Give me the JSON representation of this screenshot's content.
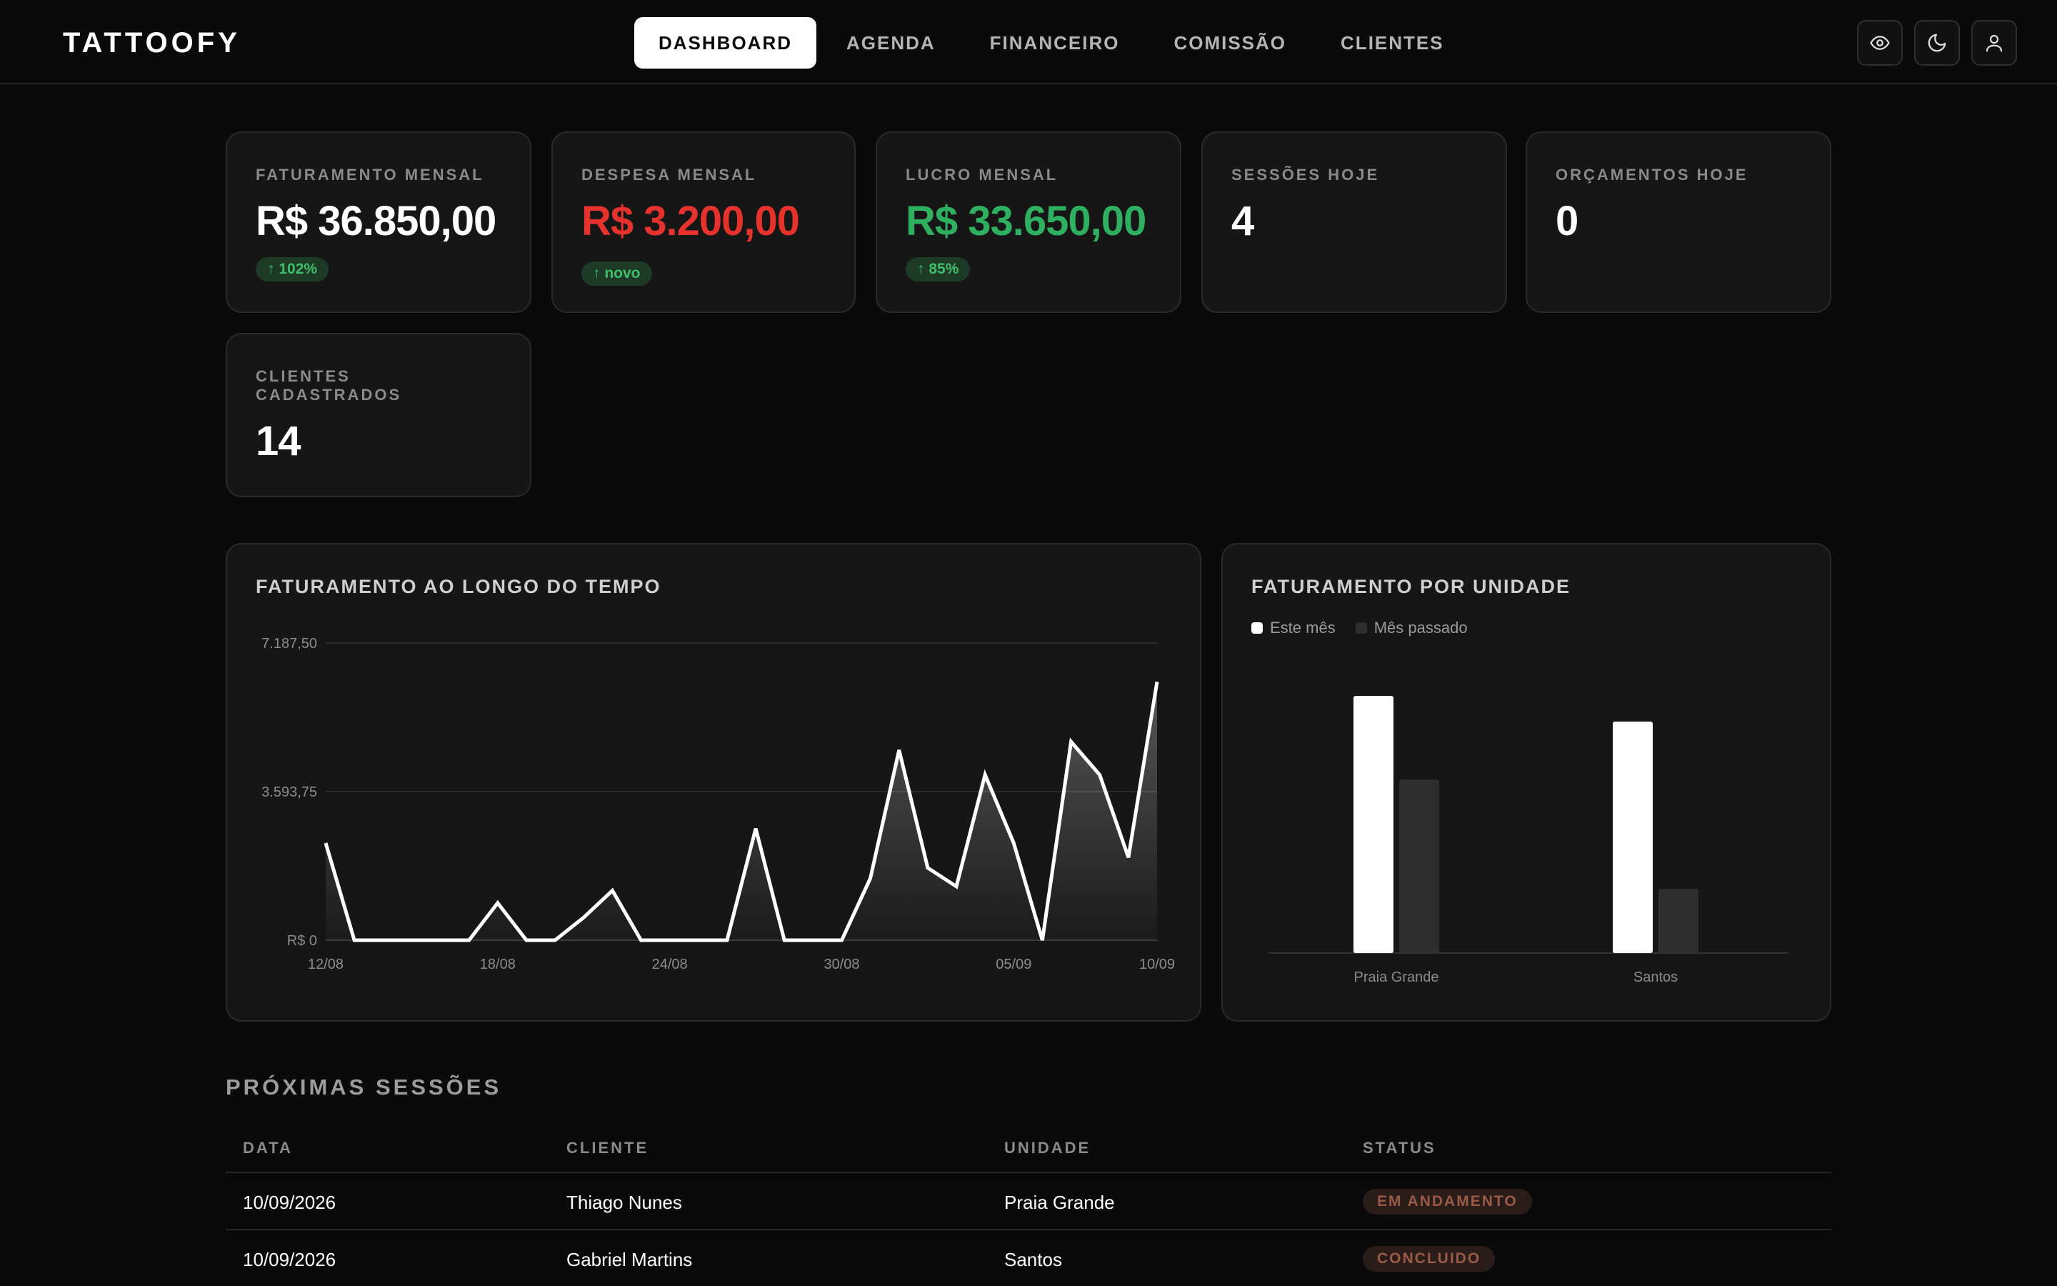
{
  "app": {
    "logo": "TATTOOFY"
  },
  "nav": {
    "items": [
      {
        "label": "DASHBOARD",
        "active": true
      },
      {
        "label": "AGENDA",
        "active": false
      },
      {
        "label": "FINANCEIRO",
        "active": false
      },
      {
        "label": "COMISSÃO",
        "active": false
      },
      {
        "label": "CLIENTES",
        "active": false
      }
    ]
  },
  "header_icons": [
    "eye-icon",
    "moon-icon",
    "user-icon"
  ],
  "stats": [
    {
      "label": "FATURAMENTO MENSAL",
      "value": "R$ 36.850,00",
      "badge": "↑ 102%",
      "color": "#ffffff"
    },
    {
      "label": "DESPESA MENSAL",
      "value": "R$ 3.200,00",
      "badge": "↑ novo",
      "color": "#e5322d"
    },
    {
      "label": "LUCRO MENSAL",
      "value": "R$ 33.650,00",
      "badge": "↑ 85%",
      "color": "#2fb061"
    },
    {
      "label": "SESSÕES HOJE",
      "value": "4"
    },
    {
      "label": "ORÇAMENTOS HOJE",
      "value": "0"
    },
    {
      "label": "CLIENTES CADASTRADOS",
      "value": "14"
    }
  ],
  "chart_data": [
    {
      "type": "area",
      "title": "FATURAMENTO AO LONGO DO TEMPO",
      "ylim": [
        0,
        7187.5
      ],
      "ytick_values": [
        0,
        3593.75,
        7187.5
      ],
      "ytick_labels": [
        "R$ 0",
        "3.593,75",
        "7.187,50"
      ],
      "xtick_labels": [
        "12/08",
        "18/08",
        "24/08",
        "30/08",
        "05/09",
        "10/09"
      ],
      "grid": true,
      "x": [
        "12/08",
        "13/08",
        "14/08",
        "15/08",
        "16/08",
        "17/08",
        "18/08",
        "19/08",
        "20/08",
        "21/08",
        "22/08",
        "23/08",
        "24/08",
        "25/08",
        "26/08",
        "27/08",
        "28/08",
        "29/08",
        "30/08",
        "31/08",
        "01/09",
        "02/09",
        "03/09",
        "04/09",
        "05/09",
        "06/09",
        "07/09",
        "08/09",
        "09/09",
        "10/09"
      ],
      "series": [
        {
          "values": [
            2350,
            0,
            0,
            0,
            0,
            0,
            900,
            0,
            0,
            550,
            1200,
            0,
            0,
            0,
            0,
            2700,
            0,
            0,
            0,
            1500,
            4600,
            1750,
            1300,
            4000,
            2350,
            0,
            4800,
            4000,
            2000,
            6250
          ]
        }
      ]
    },
    {
      "type": "bar",
      "title": "FATURAMENTO POR UNIDADE",
      "categories": [
        "Praia Grande",
        "Santos"
      ],
      "legend": "top-left",
      "ylim": [
        0,
        24000
      ],
      "series": [
        {
          "name": "Este mês",
          "color": "#ffffff",
          "values": [
            20000,
            18000
          ]
        },
        {
          "name": "Mês passado",
          "color": "#2e2e2e",
          "values": [
            13500,
            5000
          ]
        }
      ]
    }
  ],
  "sessions": {
    "title": "PRÓXIMAS SESSÕES",
    "columns": [
      "DATA",
      "CLIENTE",
      "UNIDADE",
      "STATUS"
    ],
    "rows": [
      {
        "date": "10/09/2026",
        "client": "Thiago Nunes",
        "unit": "Praia Grande",
        "status": "EM ANDAMENTO"
      },
      {
        "date": "10/09/2026",
        "client": "Gabriel Martins",
        "unit": "Santos",
        "status": "CONCLUIDO"
      }
    ]
  }
}
